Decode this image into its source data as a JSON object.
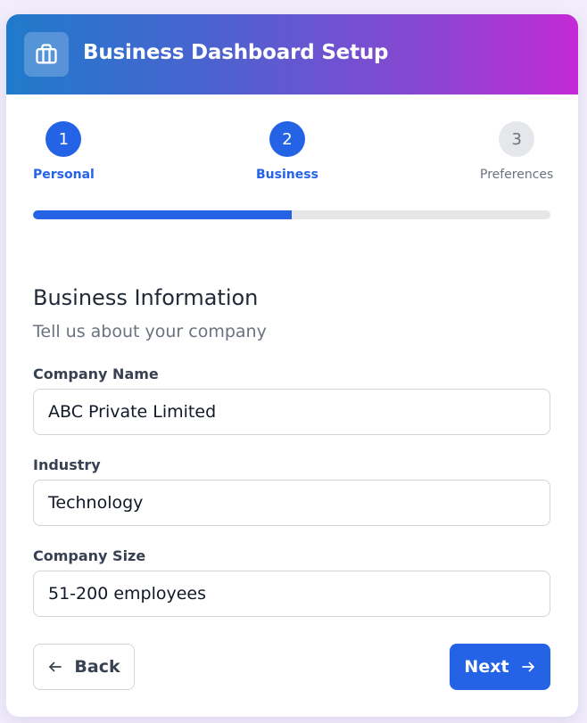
{
  "header": {
    "title": "Business Dashboard Setup",
    "icon": "briefcase-icon"
  },
  "steps": [
    {
      "number": "1",
      "label": "Personal",
      "state": "complete"
    },
    {
      "number": "2",
      "label": "Business",
      "state": "current"
    },
    {
      "number": "3",
      "label": "Preferences",
      "state": "upcoming"
    }
  ],
  "progress": {
    "percent": 50
  },
  "section": {
    "title": "Business Information",
    "subtitle": "Tell us about your company"
  },
  "fields": {
    "company_name": {
      "label": "Company Name",
      "value": "ABC Private Limited"
    },
    "industry": {
      "label": "Industry",
      "value": "Technology"
    },
    "company_size": {
      "label": "Company Size",
      "value": "51-200 employees"
    }
  },
  "buttons": {
    "back_label": "Back",
    "back_icon": "arrow-left-icon",
    "next_label": "Next",
    "next_icon": "arrow-right-icon"
  },
  "colors": {
    "accent": "#2463e6",
    "header_gradient_start": "#1f7bcc",
    "header_gradient_end": "#c42ad6",
    "inactive_step": "#e6e7eb",
    "page_background": "#f1edfb"
  }
}
